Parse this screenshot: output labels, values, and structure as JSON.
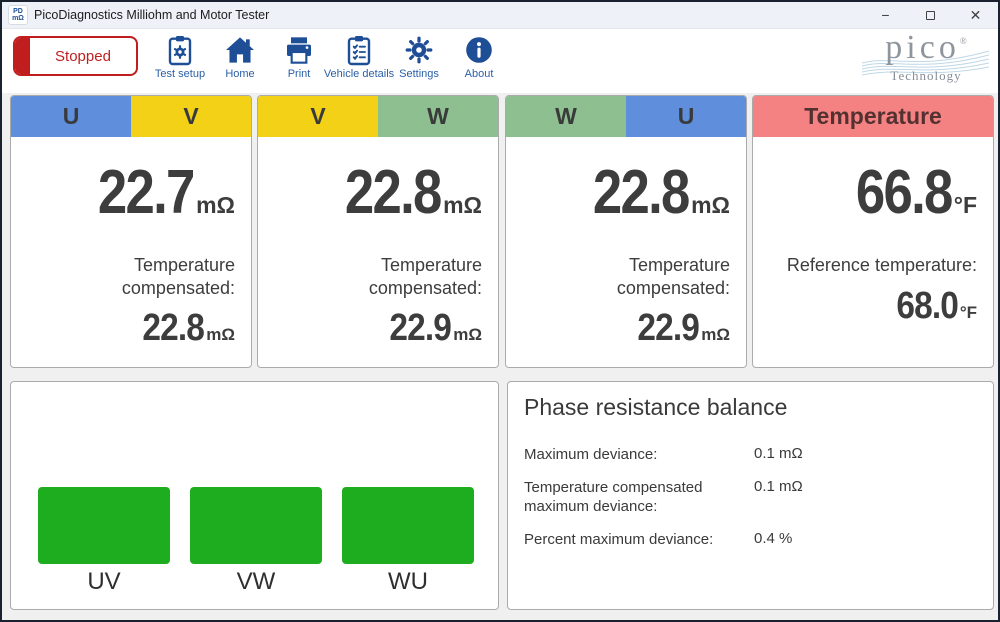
{
  "window": {
    "title": "PicoDiagnostics Milliohm and Motor Tester",
    "app_icon_top": "PD",
    "app_icon_bottom": "mΩ",
    "controls": {
      "minimize": "−",
      "close": "✕"
    }
  },
  "toolbar": {
    "status_button": "Stopped",
    "items": [
      {
        "name": "test-setup",
        "label": "Test setup",
        "icon": "clipboard-gear-icon"
      },
      {
        "name": "home",
        "label": "Home",
        "icon": "home-icon"
      },
      {
        "name": "print",
        "label": "Print",
        "icon": "printer-icon"
      },
      {
        "name": "vehicle-details",
        "label": "Vehicle details",
        "icon": "clipboard-checklist-icon"
      },
      {
        "name": "settings",
        "label": "Settings",
        "icon": "gear-icon"
      },
      {
        "name": "about",
        "label": "About",
        "icon": "info-icon"
      }
    ],
    "logo": {
      "brand": "pico",
      "registered": "®",
      "sub": "Technology"
    }
  },
  "panels": [
    {
      "left": "U",
      "right": "V",
      "value": "22.7",
      "unit": "mΩ",
      "label": "Temperature compensated:",
      "sub_value": "22.8",
      "sub_unit": "mΩ"
    },
    {
      "left": "V",
      "right": "W",
      "value": "22.8",
      "unit": "mΩ",
      "label": "Temperature compensated:",
      "sub_value": "22.9",
      "sub_unit": "mΩ"
    },
    {
      "left": "W",
      "right": "U",
      "value": "22.8",
      "unit": "mΩ",
      "label": "Temperature compensated:",
      "sub_value": "22.9",
      "sub_unit": "mΩ"
    },
    {
      "title": "Temperature",
      "value": "66.8",
      "unit": "°F",
      "label": "Reference temperature:",
      "sub_value": "68.0",
      "sub_unit": "°F"
    }
  ],
  "chart_data": {
    "type": "bar",
    "categories": [
      "UV",
      "VW",
      "WU"
    ],
    "values": [
      1,
      1,
      1
    ],
    "title": "",
    "xlabel": "",
    "ylabel": "",
    "note": "three equal-height solid green bars, no axes or gridlines; indicates balanced phase resistance",
    "bar_color": "#1fad20"
  },
  "balance": {
    "title": "Phase resistance balance",
    "rows": [
      {
        "label": "Maximum deviance:",
        "value": "0.1 mΩ"
      },
      {
        "label": "Temperature compensated maximum deviance:",
        "value": "0.1 mΩ"
      },
      {
        "label": "Percent maximum deviance:",
        "value": "0.4 %"
      }
    ]
  },
  "colors": {
    "phase_u_blue": "#5e8edc",
    "phase_v_yellow": "#f2d116",
    "phase_w_green": "#8ebf90",
    "temperature_red": "#f58282",
    "bar_green": "#1fad20",
    "status_red": "#c01e1e",
    "icon_navy": "#1d4e96",
    "titlebar_bg": "#eef1f8",
    "value_text": "#3d3d3d"
  }
}
